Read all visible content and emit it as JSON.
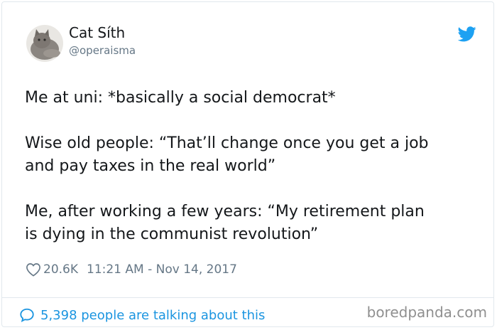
{
  "tweet": {
    "user_name": "Cat Síth",
    "user_handle": "@operaisma",
    "paragraphs": [
      "Me at uni: *basically a social democrat*",
      "Wise old people: “That’ll change once you get a job",
      "and pay taxes in the real world”",
      "Me, after working a few years: “My retirement plan",
      "is dying in the communist revolution”"
    ],
    "likes": "20.6K",
    "timestamp": "11:21 AM - Nov 14, 2017",
    "conversation": "5,398 people are talking about this"
  },
  "watermark": "boredpanda.com",
  "icons": {
    "brand": "twitter-bird-icon",
    "like": "heart-icon",
    "reply": "speech-bubble-icon"
  },
  "colors": {
    "accent": "#1da1f2",
    "link": "#1b95e0",
    "muted": "#657786",
    "text": "#14171a"
  }
}
